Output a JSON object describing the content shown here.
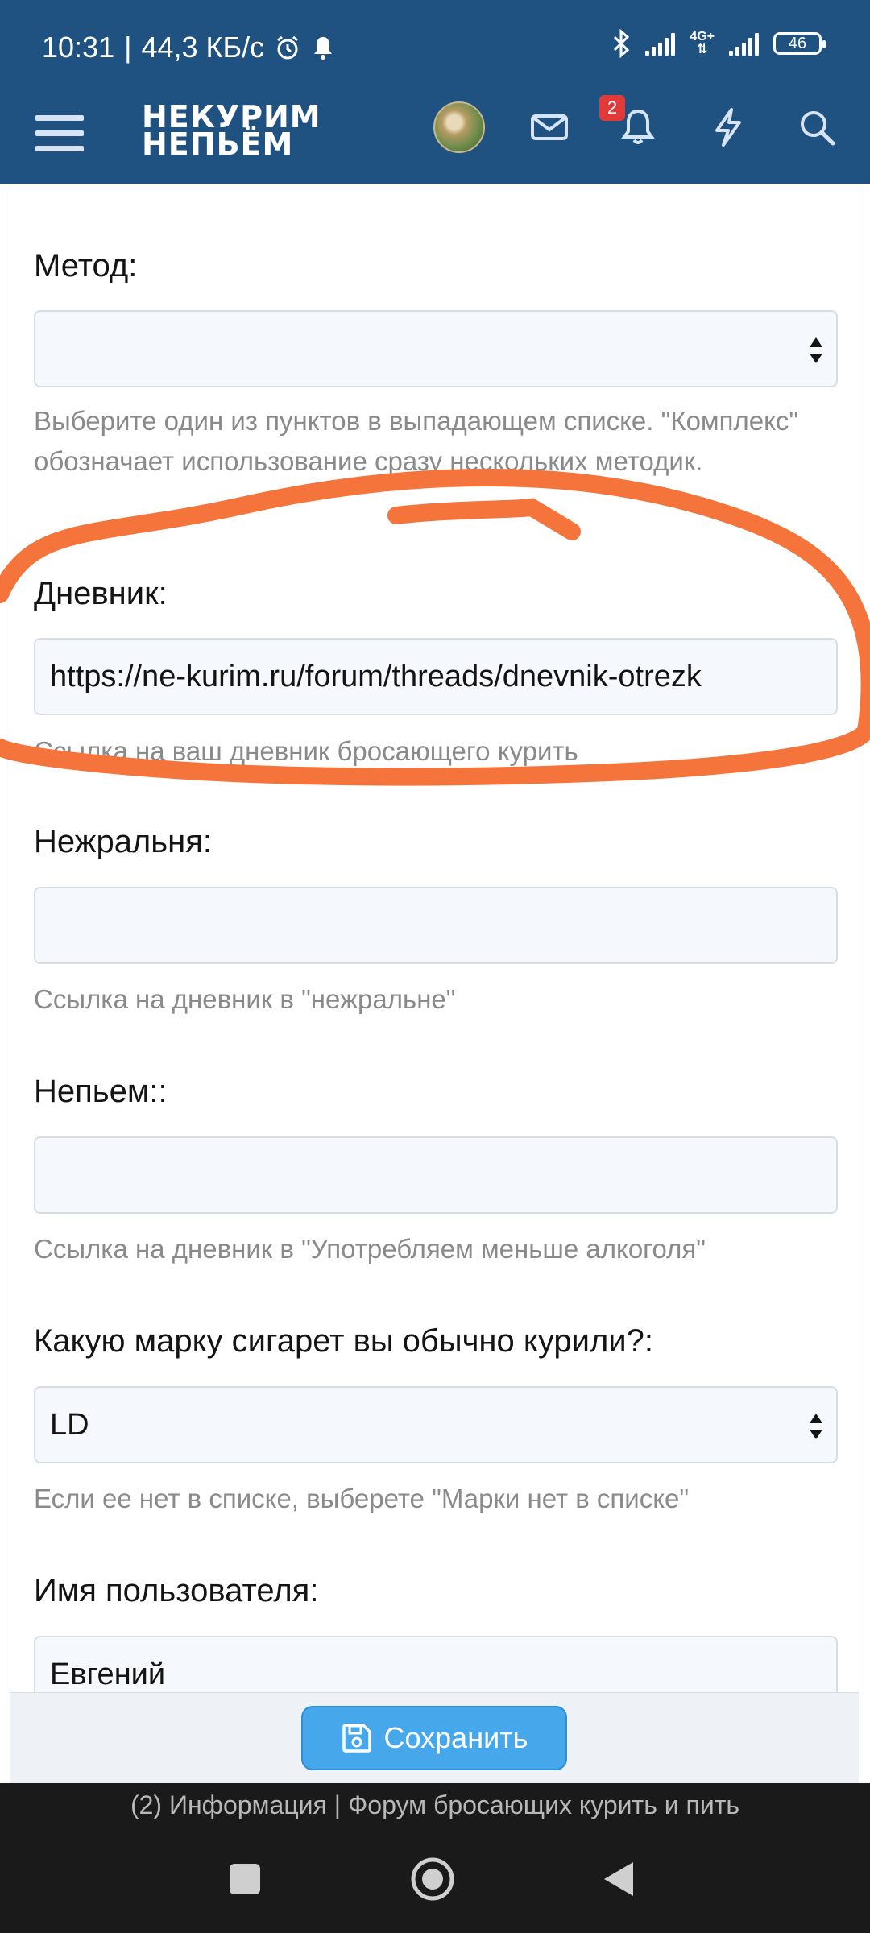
{
  "status_bar": {
    "time": "10:31",
    "speed": "44,3 КБ/с",
    "network": "4G+",
    "battery": "46"
  },
  "header": {
    "logo_line1": "НЕКУРИМ",
    "logo_line2": "НЕПЬЁМ",
    "notification_count": "2"
  },
  "form": {
    "method": {
      "label": "Метод:",
      "value": "",
      "hint": "Выберите один из пунктов в выпадающем списке. \"Комплекс\" обозначает использование сразу нескольких методик."
    },
    "diary": {
      "label": "Дневник:",
      "value": "https://ne-kurim.ru/forum/threads/dnevnik-otrezk",
      "hint": "Ссылка на ваш дневник бросающего курить"
    },
    "nezhralnya": {
      "label": "Нежральня:",
      "value": "",
      "hint": "Ссылка на дневник в \"нежральне\""
    },
    "nepyem": {
      "label": "Непьем::",
      "value": "",
      "hint": "Ссылка на дневник в \"Употребляем меньше алкоголя\""
    },
    "cigarette_brand": {
      "label": "Какую марку сигарет вы обычно курили?:",
      "value": "LD",
      "hint": "Если ее нет в списке, выберете \"Марки нет в списке\""
    },
    "username": {
      "label": "Имя пользователя:",
      "value": "Евгений"
    }
  },
  "save_button": {
    "label": "Сохранить"
  },
  "page_title": "(2) Информация | Форум бросающих курить и пить",
  "colors": {
    "header_bg": "#1f5281",
    "save_button": "#47a7eb",
    "annotation": "#f4743b",
    "badge": "#e03a3a"
  }
}
